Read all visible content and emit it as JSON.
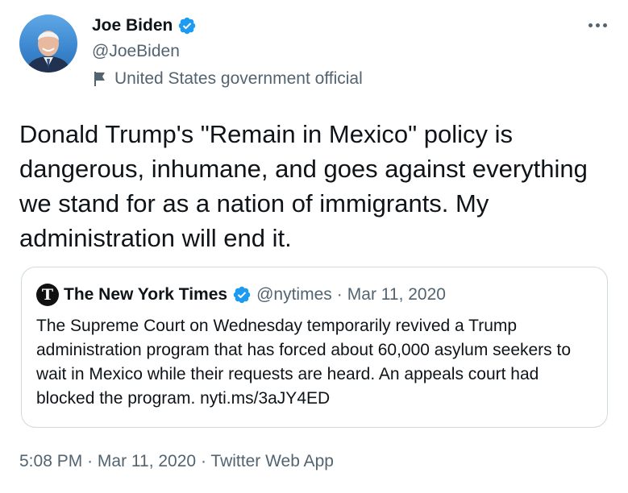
{
  "author": {
    "name": "Joe Biden",
    "handle": "@JoeBiden",
    "label": "United States government official"
  },
  "tweet": {
    "text": "Donald Trump's \"Remain in Mexico\" policy is dangerous, inhumane, and goes against everything we stand for as a nation of immigrants. My administration will end it."
  },
  "quoted": {
    "name": "The New York Times",
    "handle": "@nytimes",
    "separator": "·",
    "date": "Mar 11, 2020",
    "text": "The Supreme Court on Wednesday temporarily revived a Trump administration program that has forced about 60,000 asylum seekers to wait in Mexico while their requests are heard. An appeals court had blocked the program. nyti.ms/3aJY4ED",
    "logo_letter": "T"
  },
  "footer": {
    "time": "5:08 PM",
    "separator": "·",
    "date": "Mar 11, 2020",
    "source": "Twitter Web App"
  },
  "icons": {
    "verified": "verified-badge-icon",
    "label": "flag-icon",
    "more": "more-horizontal-icon"
  },
  "colors": {
    "text": "#0f1419",
    "secondary": "#536471",
    "verified": "#1d9bf0",
    "border": "#cfd9de"
  }
}
